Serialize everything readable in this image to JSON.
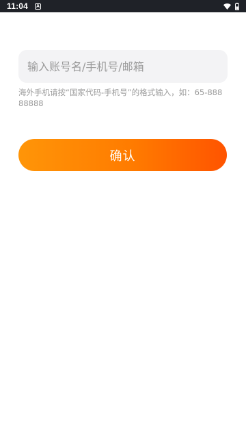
{
  "status_bar": {
    "time": "11:04",
    "notification_glyph": "A",
    "icons": [
      "a-notification-icon",
      "wifi-icon",
      "battery-icon"
    ]
  },
  "form": {
    "account_input": {
      "value": "",
      "placeholder": "输入账号名/手机号/邮箱"
    },
    "hint": "海外手机请按“国家代码-手机号”的格式输入，如：65-88888888",
    "confirm_label": "确认"
  },
  "colors": {
    "status_bar_bg": "#1f2228",
    "input_bg": "#f3f3f5",
    "hint_text": "#9a9a9a",
    "button_gradient_start": "#ff9508",
    "button_gradient_end": "#ff5400",
    "button_text": "#ffffff"
  }
}
